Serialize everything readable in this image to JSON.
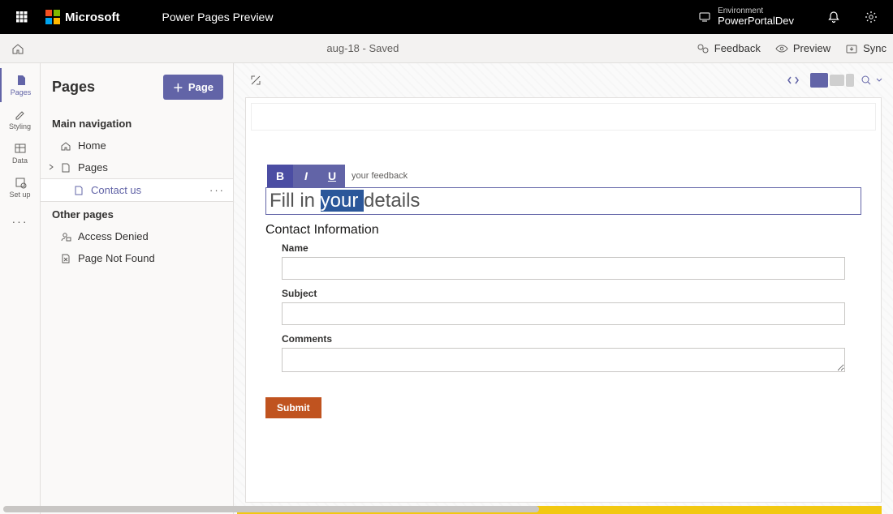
{
  "topbar": {
    "brand": "Microsoft",
    "appTitle": "Power Pages Preview",
    "envLabel": "Environment",
    "envName": "PowerPortalDev"
  },
  "cmdbar": {
    "docName": "aug-18",
    "savedSuffix": " - Saved",
    "feedback": "Feedback",
    "preview": "Preview",
    "sync": "Sync"
  },
  "rail": {
    "pages": "Pages",
    "styling": "Styling",
    "data": "Data",
    "setup": "Set up"
  },
  "sidepanel": {
    "title": "Pages",
    "addPage": "Page",
    "sectionMain": "Main navigation",
    "sectionOther": "Other pages",
    "items": {
      "home": "Home",
      "pages": "Pages",
      "contact": "Contact us",
      "accessDenied": "Access Denied",
      "notFound": "Page Not Found"
    }
  },
  "editor": {
    "toolbarHint": "your feedback",
    "heading_pre": "Fill in ",
    "heading_sel": "your ",
    "heading_post": "details",
    "subhead": "Contact Information",
    "fields": {
      "name": "Name",
      "subject": "Subject",
      "comments": "Comments"
    },
    "submit": "Submit"
  },
  "fmt": {
    "b": "B",
    "i": "I",
    "u": "U"
  }
}
